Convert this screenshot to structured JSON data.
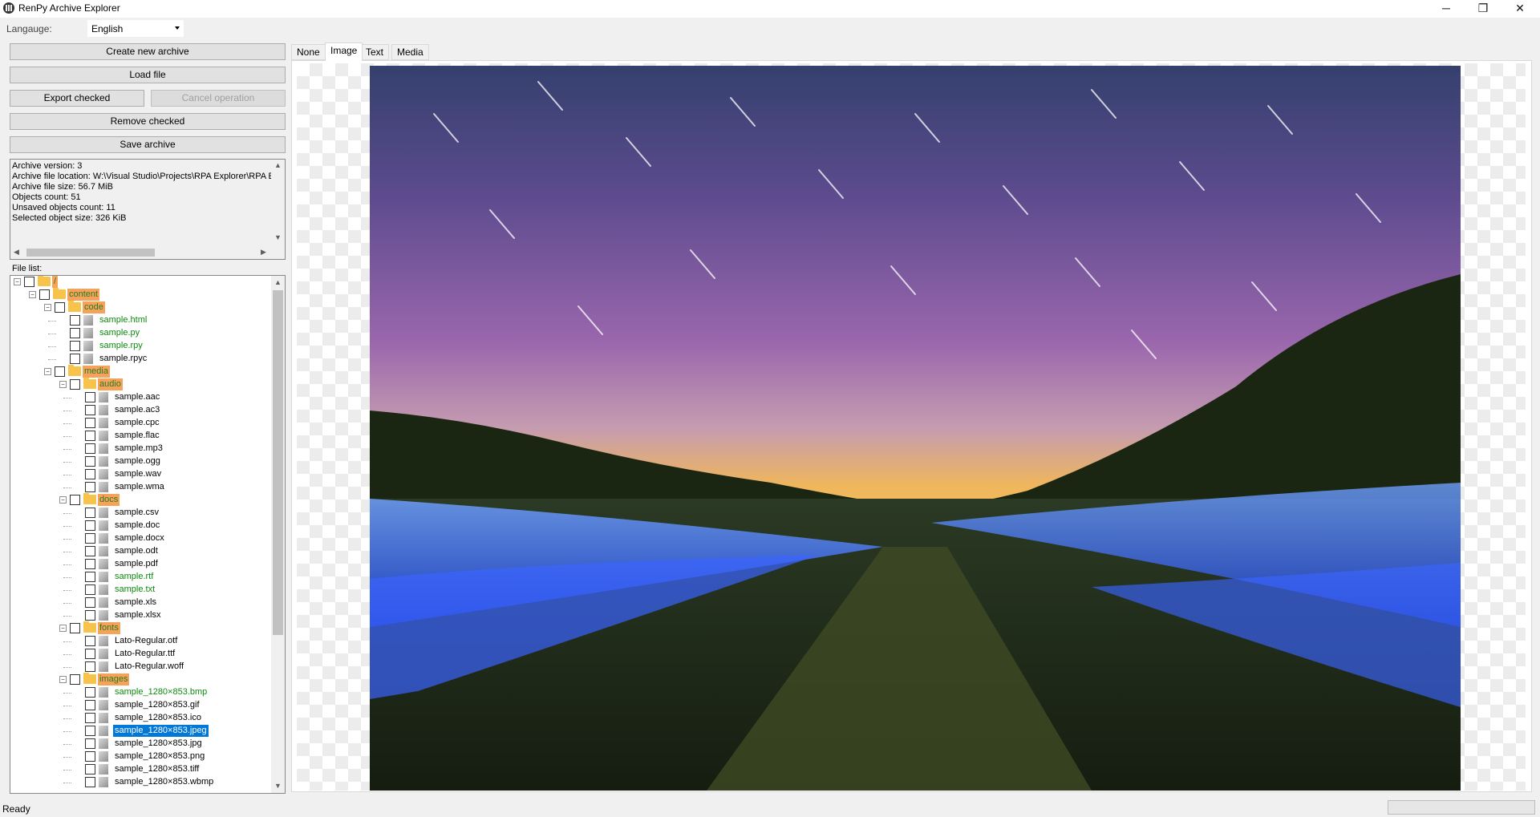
{
  "window": {
    "title": "RenPy Archive Explorer",
    "minimize": "─",
    "maximize": "❐",
    "close": "✕"
  },
  "language": {
    "label": "Langauge:",
    "value": "English"
  },
  "buttons": {
    "create": "Create new archive",
    "load": "Load file",
    "export": "Export checked",
    "cancel": "Cancel operation",
    "remove": "Remove checked",
    "save": "Save archive"
  },
  "info": {
    "lines": [
      "Archive version: 3",
      "Archive file location: W:\\Visual Studio\\Projects\\RPA Explorer\\RPA Explorer\\",
      "Archive file size: 56.7 MiB",
      "Objects count: 51",
      "Unsaved objects count: 11",
      "Selected object size: 326 KiB"
    ]
  },
  "file_list_label": "File list:",
  "tree": [
    {
      "label": "/",
      "depth": 0,
      "kind": "dir"
    },
    {
      "label": "content",
      "depth": 1,
      "kind": "dir"
    },
    {
      "label": "code",
      "depth": 2,
      "kind": "dir"
    },
    {
      "label": "sample.html",
      "depth": 3,
      "kind": "unsaved"
    },
    {
      "label": "sample.py",
      "depth": 3,
      "kind": "unsaved"
    },
    {
      "label": "sample.rpy",
      "depth": 3,
      "kind": "unsaved"
    },
    {
      "label": "sample.rpyc",
      "depth": 3,
      "kind": "saved"
    },
    {
      "label": "media",
      "depth": 2,
      "kind": "dir"
    },
    {
      "label": "audio",
      "depth": 3,
      "kind": "dir"
    },
    {
      "label": "sample.aac",
      "depth": 4,
      "kind": "saved"
    },
    {
      "label": "sample.ac3",
      "depth": 4,
      "kind": "saved"
    },
    {
      "label": "sample.cpc",
      "depth": 4,
      "kind": "saved"
    },
    {
      "label": "sample.flac",
      "depth": 4,
      "kind": "saved"
    },
    {
      "label": "sample.mp3",
      "depth": 4,
      "kind": "saved"
    },
    {
      "label": "sample.ogg",
      "depth": 4,
      "kind": "saved"
    },
    {
      "label": "sample.wav",
      "depth": 4,
      "kind": "saved"
    },
    {
      "label": "sample.wma",
      "depth": 4,
      "kind": "saved"
    },
    {
      "label": "docs",
      "depth": 3,
      "kind": "dir"
    },
    {
      "label": "sample.csv",
      "depth": 4,
      "kind": "saved"
    },
    {
      "label": "sample.doc",
      "depth": 4,
      "kind": "saved"
    },
    {
      "label": "sample.docx",
      "depth": 4,
      "kind": "saved"
    },
    {
      "label": "sample.odt",
      "depth": 4,
      "kind": "saved"
    },
    {
      "label": "sample.pdf",
      "depth": 4,
      "kind": "saved"
    },
    {
      "label": "sample.rtf",
      "depth": 4,
      "kind": "unsaved"
    },
    {
      "label": "sample.txt",
      "depth": 4,
      "kind": "unsaved"
    },
    {
      "label": "sample.xls",
      "depth": 4,
      "kind": "saved"
    },
    {
      "label": "sample.xlsx",
      "depth": 4,
      "kind": "saved"
    },
    {
      "label": "fonts",
      "depth": 3,
      "kind": "dir"
    },
    {
      "label": "Lato-Regular.otf",
      "depth": 4,
      "kind": "saved"
    },
    {
      "label": "Lato-Regular.ttf",
      "depth": 4,
      "kind": "saved"
    },
    {
      "label": "Lato-Regular.woff",
      "depth": 4,
      "kind": "saved"
    },
    {
      "label": "images",
      "depth": 3,
      "kind": "dir"
    },
    {
      "label": "sample_1280×853.bmp",
      "depth": 4,
      "kind": "unsaved"
    },
    {
      "label": "sample_1280×853.gif",
      "depth": 4,
      "kind": "saved"
    },
    {
      "label": "sample_1280×853.ico",
      "depth": 4,
      "kind": "saved"
    },
    {
      "label": "sample_1280×853.jpeg",
      "depth": 4,
      "kind": "selected"
    },
    {
      "label": "sample_1280×853.jpg",
      "depth": 4,
      "kind": "saved"
    },
    {
      "label": "sample_1280×853.png",
      "depth": 4,
      "kind": "saved"
    },
    {
      "label": "sample_1280×853.tiff",
      "depth": 4,
      "kind": "saved"
    },
    {
      "label": "sample_1280×853.wbmp",
      "depth": 4,
      "kind": "saved"
    }
  ],
  "tabs": [
    "None",
    "Image",
    "Text",
    "Media"
  ],
  "active_tab": "Image",
  "status": "Ready",
  "colors": {
    "dir_highlight": "#f5a35a",
    "unsaved_text": "#0e8a0e",
    "selection": "#0078d7"
  }
}
